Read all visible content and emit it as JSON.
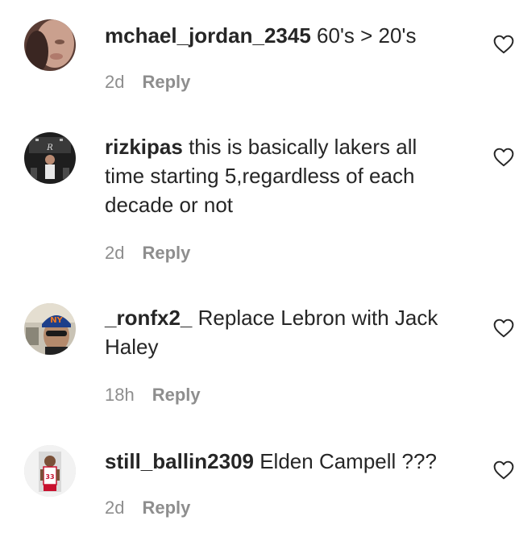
{
  "comments": [
    {
      "username": "mchael_jordan_2345",
      "text": "60's > 20's",
      "age": "2d",
      "reply_label": "Reply",
      "avatar_icon": "profile-photo-icon",
      "like_icon": "heart-outline-icon"
    },
    {
      "username": "rizkipas",
      "text": "this is basically lakers all time starting 5,regardless of each decade or not",
      "age": "2d",
      "reply_label": "Reply",
      "avatar_icon": "profile-photo-icon",
      "like_icon": "heart-outline-icon"
    },
    {
      "username": "_ronfx2_",
      "text": "Replace Lebron with Jack Haley",
      "age": "18h",
      "reply_label": "Reply",
      "avatar_icon": "profile-photo-icon",
      "like_icon": "heart-outline-icon"
    },
    {
      "username": "still_ballin2309",
      "text": "Elden Campell ???",
      "age": "2d",
      "reply_label": "Reply",
      "avatar_icon": "profile-photo-icon",
      "like_icon": "heart-outline-icon"
    }
  ],
  "colors": {
    "text": "#262626",
    "secondary": "#8e8e8e"
  }
}
